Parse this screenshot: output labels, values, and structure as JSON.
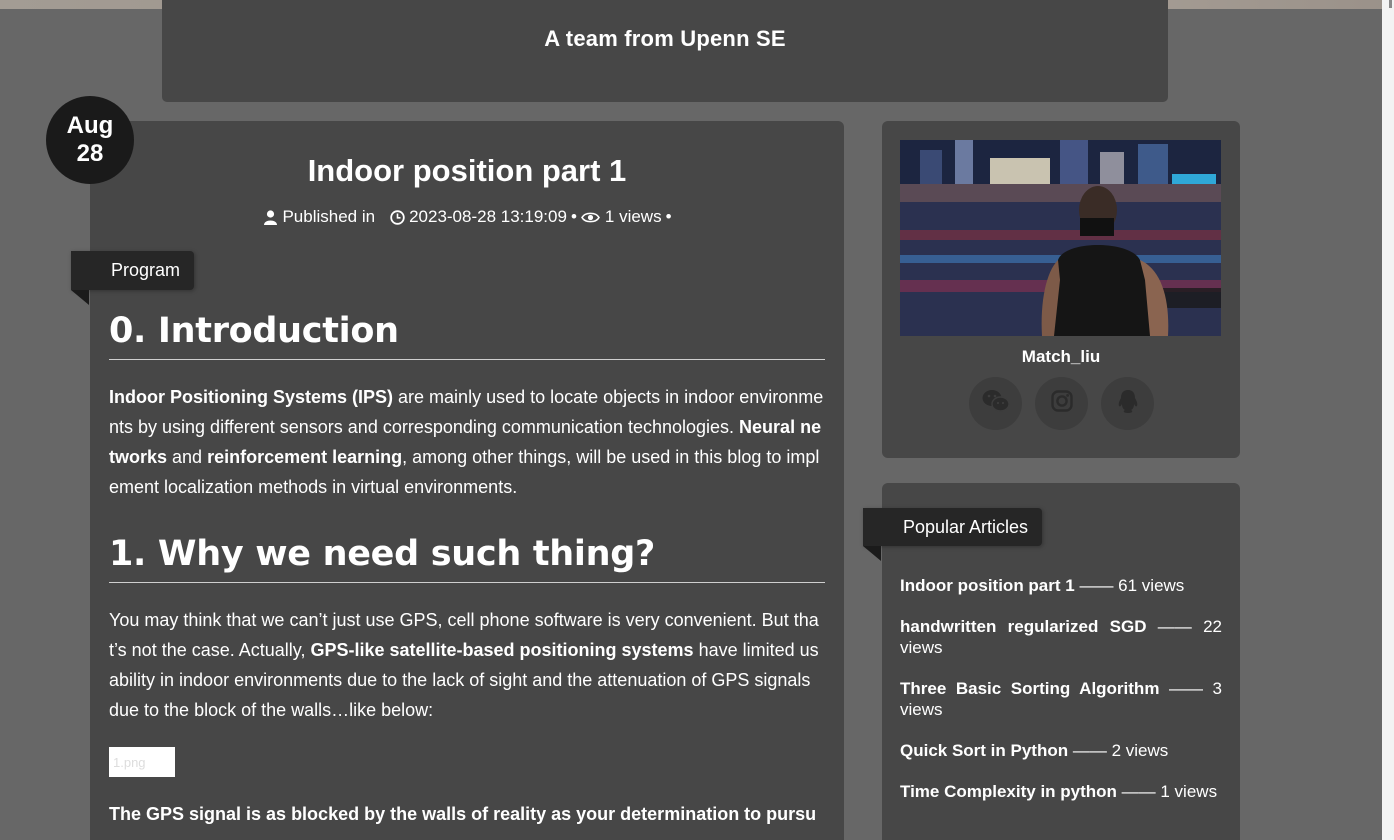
{
  "header": {
    "site_title": "A team from Upenn SE"
  },
  "date_badge": {
    "month": "Aug",
    "day": "28"
  },
  "article": {
    "title": "Indoor position part 1",
    "meta": {
      "published_in": "Published in",
      "datetime": "2023-08-28 13:19:09",
      "views": "1 views",
      "sep": "•"
    },
    "tag": "Program",
    "sections": {
      "intro_heading": "0. Introduction",
      "intro_p": {
        "b1": "Indoor Positioning Systems (IPS)",
        "t1": " are mainly used to locate objects in indoor environments by using different sensors and corresponding communication technologies. ",
        "b2": "Neural networks",
        "t2": " and ",
        "b3": "reinforcement learning",
        "t3": ", among other things, will be used in this blog to implement localization methods in virtual environments."
      },
      "why_heading": "1. Why we need such thing?",
      "why_p": {
        "t1": "You may think that we can’t just use GPS, cell phone software is very convenient. But that’s not the case. Actually, ",
        "b1": "GPS-like satellite-based positioning systems",
        "t2": " have limited usability in indoor environments due to the lack of sight and the attenuation of GPS signals due to the block of the walls…like below:"
      },
      "image_alt": "1.png",
      "bold_line": "The GPS signal is as blocked by the walls of reality as your determination to pursue"
    }
  },
  "profile": {
    "name": "Match_liu",
    "social": [
      "wechat-icon",
      "instagram-icon",
      "qq-icon"
    ]
  },
  "popular": {
    "heading": "Popular Articles",
    "items": [
      {
        "title": "Indoor position part 1",
        "views": " —— 61 views"
      },
      {
        "title": "handwritten regularized SGD",
        "views": " —— 22 views"
      },
      {
        "title": "Three Basic Sorting Algorithm",
        "views": " —— 3 views"
      },
      {
        "title": "Quick Sort in Python",
        "views": " —— 2 views"
      },
      {
        "title": "Time Complexity in python",
        "views": " —— 1 views"
      }
    ]
  }
}
